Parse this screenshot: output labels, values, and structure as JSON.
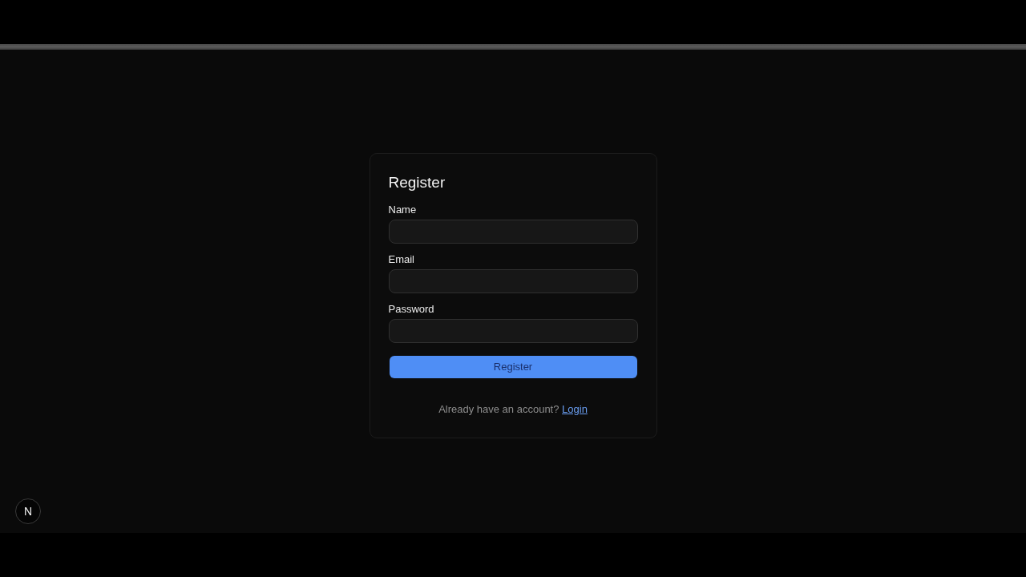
{
  "form": {
    "title": "Register",
    "fields": [
      {
        "label": "Name"
      },
      {
        "label": "Email"
      },
      {
        "label": "Password"
      }
    ],
    "submit": "Register",
    "footer": {
      "text": "Already have an account?",
      "link": "Login"
    }
  },
  "dev_badge": {
    "label": "N"
  }
}
